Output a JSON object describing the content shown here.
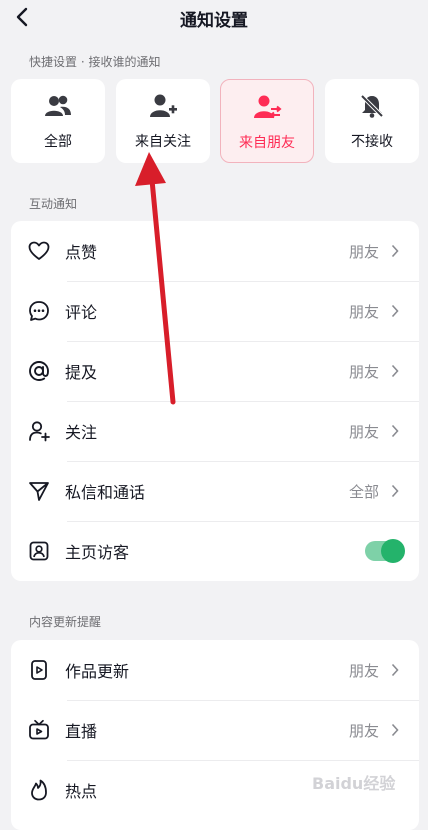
{
  "header": {
    "title": "通知设置",
    "back_icon": "chevron-left-icon"
  },
  "quick_settings": {
    "section_label": "快捷设置 · 接收谁的通知",
    "options": [
      {
        "label": "全部",
        "icon": "users-icon",
        "selected": false
      },
      {
        "label": "来自关注",
        "icon": "user-plus-icon",
        "selected": false
      },
      {
        "label": "来自朋友",
        "icon": "user-swap-icon",
        "selected": true
      },
      {
        "label": "不接收",
        "icon": "bell-off-icon",
        "selected": false
      }
    ]
  },
  "interaction": {
    "section_label": "互动通知",
    "rows": [
      {
        "label": "点赞",
        "value": "朋友",
        "icon": "heart-icon"
      },
      {
        "label": "评论",
        "value": "朋友",
        "icon": "comment-icon"
      },
      {
        "label": "提及",
        "value": "朋友",
        "icon": "at-icon"
      },
      {
        "label": "关注",
        "value": "朋友",
        "icon": "user-plus-icon"
      },
      {
        "label": "私信和通话",
        "value": "全部",
        "icon": "send-icon"
      },
      {
        "label": "主页访客",
        "value": "",
        "icon": "profile-icon",
        "toggle_on": true
      }
    ]
  },
  "content_updates": {
    "section_label": "内容更新提醒",
    "rows": [
      {
        "label": "作品更新",
        "value": "朋友",
        "icon": "video-icon"
      },
      {
        "label": "直播",
        "value": "朋友",
        "icon": "live-tv-icon"
      },
      {
        "label": "热点",
        "value": "",
        "icon": "flame-icon"
      }
    ]
  },
  "watermark": "Baidu经验",
  "colors": {
    "accent": "#fe2c55",
    "toggle_on": "#24b36b",
    "annotation_arrow": "#d81e2a"
  }
}
